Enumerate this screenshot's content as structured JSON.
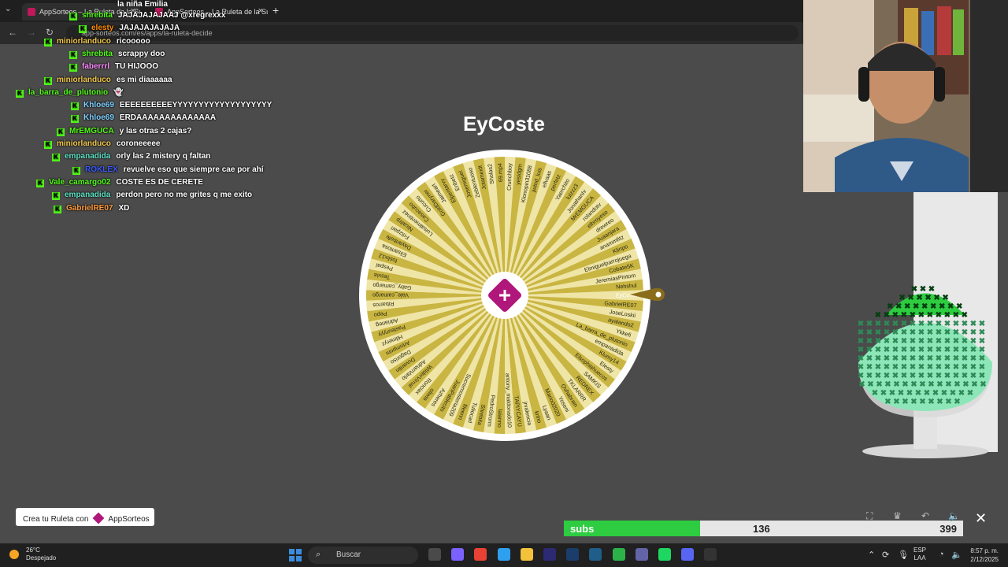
{
  "browser": {
    "tabs": [
      {
        "label": "AppSorteos – La Ruleta de la Su",
        "active": true
      },
      {
        "label": "AppSorteos – La Ruleta de la Su",
        "active": false
      }
    ],
    "url": "app-sorteos.com/es/apps/la-ruleta-decide"
  },
  "chat": {
    "top_text": "la niña Emilia",
    "messages": [
      {
        "user": "shrebita",
        "color": "#53fc18",
        "text": "JAJAJAJAJAAJ @xregrexxx"
      },
      {
        "user": "elesty",
        "color": "#ff8c00",
        "text": "JAJAJAJAJAJA"
      },
      {
        "user": "miniorlanduco",
        "color": "#f2c94c",
        "text": "ricooooo"
      },
      {
        "user": "shrebita",
        "color": "#53fc18",
        "text": "scrappy doo"
      },
      {
        "user": "faberrrl",
        "color": "#ff8cff",
        "text": "TU HIJOOO"
      },
      {
        "user": "miniorlanduco",
        "color": "#f2c94c",
        "text": "es mi diaaaaaa"
      },
      {
        "user": "la_barra_de_plutonio",
        "color": "#53fc18",
        "text": "👻"
      },
      {
        "user": "Khloe69",
        "color": "#7fd0ff",
        "text": "EEEEEEEEEEYYYYYYYYYYYYYYYYYYY"
      },
      {
        "user": "Khloe69",
        "color": "#7fd0ff",
        "text": "ERDAAAAAAAAAAAAAA"
      },
      {
        "user": "MrEMGUCA",
        "color": "#53fc18",
        "text": "y las otras 2 cajas?"
      },
      {
        "user": "miniorlanduco",
        "color": "#f2c94c",
        "text": "coroneeeee"
      },
      {
        "user": "empanadida",
        "color": "#5fe3c8",
        "text": "orly las 2 mistery q faltan"
      },
      {
        "user": "ROKLEX",
        "color": "#3b5bff",
        "text": "revuelve eso que siempre cae por ahí"
      },
      {
        "user": "Vale_camargo02",
        "color": "#53fc18",
        "text": "COSTE ES DE CERETE"
      },
      {
        "user": "empanadida",
        "color": "#5fe3c8",
        "text": "perdon pero no me grites q me exito"
      },
      {
        "user": "GabrielRE07",
        "color": "#ff9a3c",
        "text": "XD"
      }
    ]
  },
  "wheel": {
    "winner": "EyCoste",
    "colors": {
      "dark": "#c9b541",
      "light": "#efe5a6",
      "rim": "#ffffff",
      "pointer": "#8a6d1b",
      "center_logo": "#b0177a"
    },
    "names": [
      "EyCoste",
      "GabrielRE07",
      "JoseLoskii",
      "ayalando2",
      "Ykkefi",
      "La_barra_de_plutonio",
      "empanadida",
      "Klumy14",
      "Elesty",
      "Elsophiahuecos",
      "SAMKIS",
      "REDREX",
      "TKLARRR",
      "Ovhabrain",
      "Yoseni",
      "Mario02020",
      "Lyaan",
      "knho",
      "jrvalencia",
      "TAPIYCAYU",
      "antony_maldonado10",
      "laianno",
      "PedroStrorm",
      "Shrebita",
      "Tuliocarl",
      "fileenn",
      "Sucremosteria209",
      "JuanPablecito",
      "Azheres",
      "oliwia",
      "Ronciax",
      "WilderVirnal",
      "AdrianVarlo",
      "Duvanlin",
      "Dagoriso",
      "Artnmprim",
      "Hilmeryz",
      "Pasteuryyy",
      "Adrianeg",
      "Pepo",
      "Ribarros",
      "Vale_camargo",
      "Gaby_camargo",
      "Tesvia",
      "Pespal",
      "foslix12",
      "Elisantosa",
      "Dayanbofe",
      "Fritzpari",
      "Nicaitrp",
      "Luisalmentinez",
      "Casacubo",
      "Cucurto",
      "GoldDaryner",
      "Jaimeart",
      "Elpentarvy",
      "Enbetz",
      "Josemiguel",
      "Zeblentuoso",
      "Jotameidt",
      "Sholas2",
      "69.mp4",
      "Crunchboy",
      "yesidgm",
      "Klonopin31088",
      "jwtnd_luis",
      "ellvaas",
      "perfetz",
      "Yaerchito",
      "luizzz3",
      "JonathanIv",
      "MrEMGUCA",
      "rolandotv",
      "elhroyeso",
      "drewreo",
      "Juaanjara",
      "anammfitz",
      "Klinpo",
      "Elmiguelparrojuega",
      "Cobate5K",
      "JeremiasPintom",
      "Nehshul"
    ]
  },
  "create_button": {
    "prefix": "Crea tu Ruleta con",
    "brand": "AppSorteos"
  },
  "subs": {
    "label": "subs",
    "current": "136",
    "goal": "399",
    "current_value": 136,
    "goal_value": 399
  },
  "overlay_icons": [
    "expand-icon",
    "trophy-icon",
    "undo-icon",
    "volume-icon"
  ],
  "taskbar": {
    "weather_temp": "26°C",
    "weather_desc": "Despejado",
    "search_placeholder": "Buscar",
    "lang": "ESP",
    "lang_sub": "LAA",
    "time": "8:57 p. m.",
    "date": "2/12/2025",
    "apps": [
      {
        "name": "file-explorer-icon",
        "color": "#4a4a4a"
      },
      {
        "name": "copilot-icon",
        "color": "#7b61ff"
      },
      {
        "name": "chrome-icon",
        "color": "#e94235"
      },
      {
        "name": "edge-icon",
        "color": "#2f9ff0"
      },
      {
        "name": "folder-icon",
        "color": "#f3c13a"
      },
      {
        "name": "premiere-icon",
        "color": "#2c2a73"
      },
      {
        "name": "audition-icon",
        "color": "#1b3d6b"
      },
      {
        "name": "steam-icon",
        "color": "#1f5d8a"
      },
      {
        "name": "green-app-icon",
        "color": "#2bb34a"
      },
      {
        "name": "teams-icon",
        "color": "#6264a7"
      },
      {
        "name": "spotify-icon",
        "color": "#1ed760"
      },
      {
        "name": "discord-icon",
        "color": "#5865f2"
      },
      {
        "name": "obs-icon",
        "color": "#333333"
      }
    ]
  }
}
